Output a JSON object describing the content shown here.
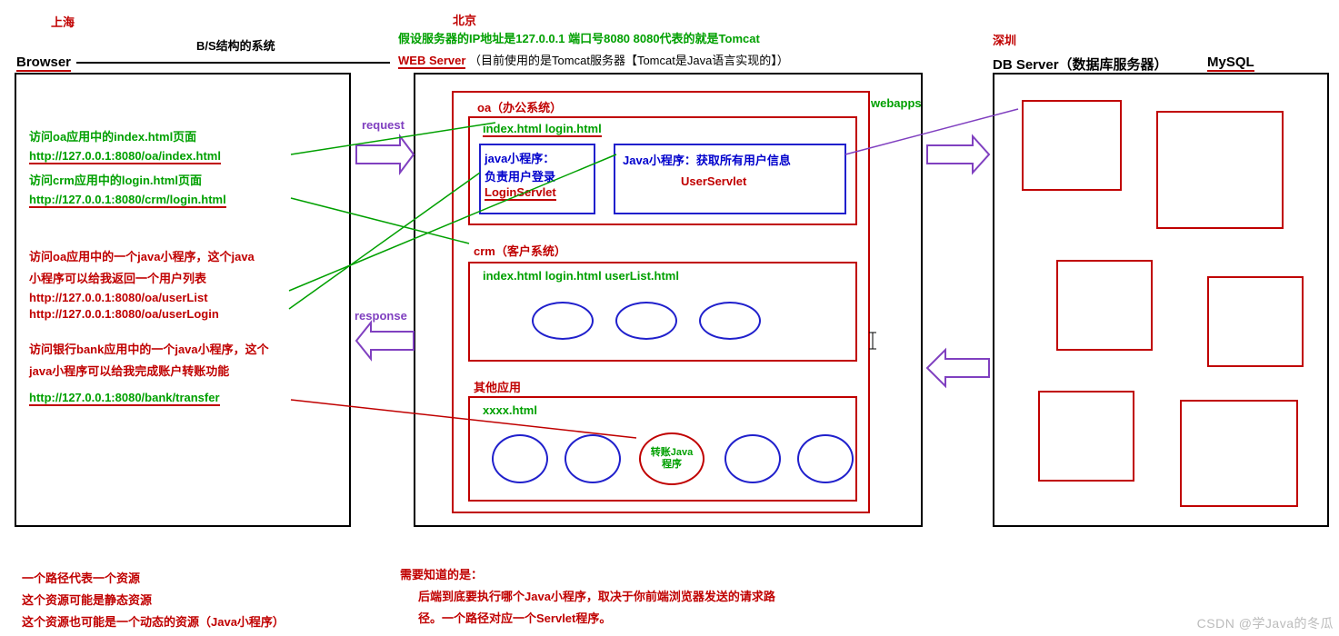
{
  "header": {
    "shanghai": "上海",
    "bs_system": "B/S结构的系统",
    "browser": "Browser",
    "beijing": "北京",
    "ip_assume": "假设服务器的IP地址是127.0.0.1 端口号8080    8080代表的就是Tomcat",
    "web_server": "WEB Server",
    "web_server_note": "（目前使用的是Tomcat服务器【Tomcat是Java语言实现的】）",
    "shenzhen": "深圳",
    "db_server": "DB Server（数据库服务器）",
    "mysql": "MySQL"
  },
  "browser": {
    "l1": "访问oa应用中的index.html页面",
    "l2": "http://127.0.0.1:8080/oa/index.html",
    "l3": "访问crm应用中的login.html页面",
    "l4": "http://127.0.0.1:8080/crm/login.html",
    "l5": "访问oa应用中的一个java小程序，这个java",
    "l6": "小程序可以给我返回一个用户列表",
    "l7": "http://127.0.0.1:8080/oa/userList",
    "l8": "http://127.0.0.1:8080/oa/userLogin",
    "l9": "访问银行bank应用中的一个java小程序，这个",
    "l10": "java小程序可以给我完成账户转账功能",
    "l11": "http://127.0.0.1:8080/bank/transfer"
  },
  "arrows": {
    "request": "request",
    "response": "response",
    "webapps": "webapps"
  },
  "server": {
    "oa_title": "oa（办公系统）",
    "oa_files": "index.html  login.html",
    "login_servlet_1": "java小程序：",
    "login_servlet_2": "负责用户登录",
    "login_servlet_3": "LoginServlet",
    "user_servlet_1": "Java小程序：获取所有用户信息",
    "user_servlet_2": "UserServlet",
    "crm_title": "crm（客户系统）",
    "crm_files": "index.html  login.html userList.html",
    "other_title": "其他应用",
    "other_files": "xxxx.html",
    "transfer_1": "转账Java",
    "transfer_2": "程序"
  },
  "footer": {
    "f1": "一个路径代表一个资源",
    "f2": "这个资源可能是静态资源",
    "f3": "这个资源也可能是一个动态的资源（Java小程序）",
    "n1": "需要知道的是：",
    "n2": "后端到底要执行哪个Java小程序，取决于你前端浏览器发送的请求路",
    "n3": "径。一个路径对应一个Servlet程序。"
  },
  "watermark": "CSDN @学Java的冬瓜"
}
